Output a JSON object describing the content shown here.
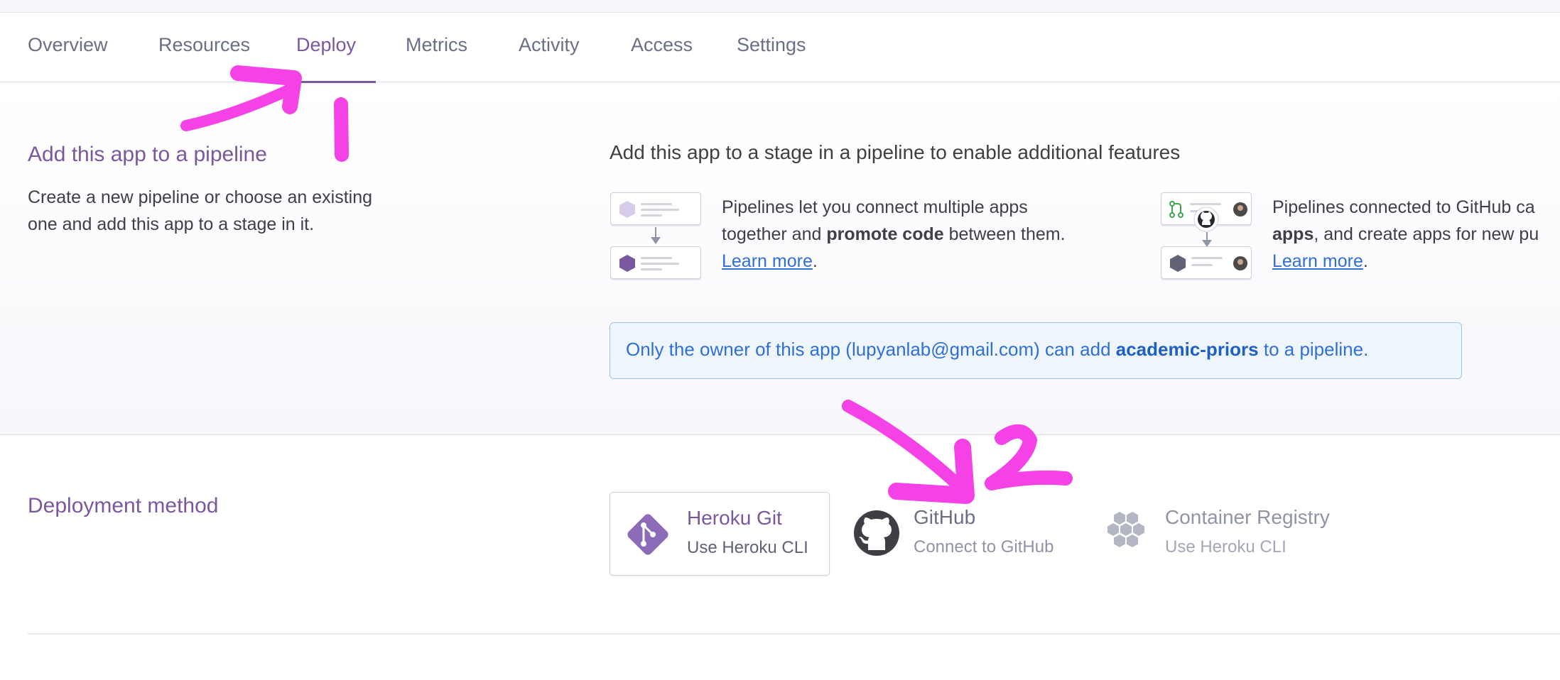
{
  "tabs": [
    {
      "label": "Overview"
    },
    {
      "label": "Resources"
    },
    {
      "label": "Deploy",
      "active": true
    },
    {
      "label": "Metrics"
    },
    {
      "label": "Activity"
    },
    {
      "label": "Access"
    },
    {
      "label": "Settings"
    }
  ],
  "pipeline": {
    "title": "Add this app to a pipeline",
    "description_line1": "Create a new pipeline or choose an existing",
    "description_line2": "one and add this app to a stage in it.",
    "heading": "Add this app to a stage in a pipeline to enable additional features",
    "feature1": {
      "line1": "Pipelines let you connect multiple apps",
      "line2_pre": "together and ",
      "line2_bold": "promote code",
      "line2_post": " between them.",
      "link": "Learn more",
      "link_suffix": "."
    },
    "feature2": {
      "line1": "Pipelines connected to GitHub ca",
      "line2_bold": "apps",
      "line2_post": ", and create apps for new pu",
      "link": "Learn more",
      "link_suffix": "."
    },
    "notice": {
      "pre": "Only the owner of this app (lupyanlab@gmail.com) can add ",
      "app_name": "academic-priors",
      "post": " to a pipeline."
    }
  },
  "deployment": {
    "title": "Deployment method",
    "methods": [
      {
        "name": "Heroku Git",
        "sub": "Use Heroku CLI",
        "icon": "heroku-git-icon",
        "selected": true
      },
      {
        "name": "GitHub",
        "sub": "Connect to GitHub",
        "icon": "github-icon",
        "selected": false
      },
      {
        "name": "Container Registry",
        "sub": "Use Heroku CLI",
        "icon": "container-registry-icon",
        "selected": false
      }
    ]
  },
  "annotations": {
    "label1": "1",
    "label2": "2",
    "color": "#f542e6"
  },
  "colors": {
    "accent": "#79589f",
    "link": "#2f6fd6",
    "notice_bg": "#eef5fd",
    "notice_border": "#9ec1ea"
  }
}
